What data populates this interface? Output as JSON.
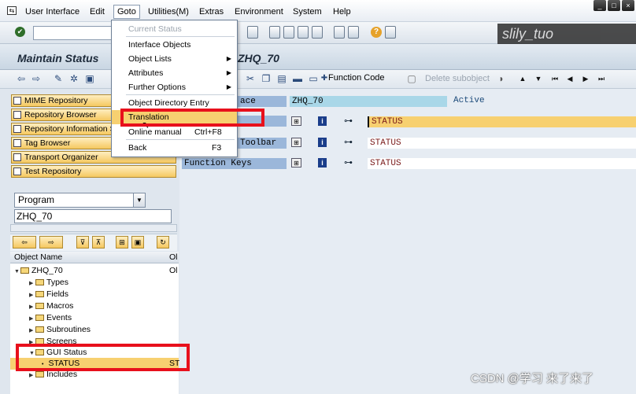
{
  "menubar": {
    "items": [
      "User Interface",
      "Edit",
      "Goto",
      "Utilities(M)",
      "Extras",
      "Environment",
      "System",
      "Help"
    ]
  },
  "title": {
    "left": "Maintain Status",
    "right": "ZHQ_70"
  },
  "app_toolbar": {
    "function_code": "Function Code",
    "delete_subobject": "Delete subobject"
  },
  "nav_buttons": [
    "MIME Repository",
    "Repository Browser",
    "Repository Information S",
    "Tag Browser",
    "Transport Organizer",
    "Test Repository"
  ],
  "object_selector": {
    "type": "Program",
    "name": "ZHQ_70"
  },
  "tree": {
    "header": "Object Name",
    "header_right": "Ol",
    "root": "ZHQ_70",
    "children": [
      "Types",
      "Fields",
      "Macros",
      "Events",
      "Subroutines",
      "Screens"
    ],
    "gui_status": "GUI Status",
    "gui_status_child": "STATUS",
    "gui_status_child_right": "ST",
    "includes": "Includes"
  },
  "right_pane": {
    "interface_label": "ace",
    "interface_value": "ZHQ_70",
    "interface_status": "Active",
    "rows": [
      {
        "label": "",
        "value": "STATUS"
      },
      {
        "label": "Toolbar",
        "value": "STATUS"
      },
      {
        "label": "Function Keys",
        "value": "STATUS"
      }
    ]
  },
  "dropdown": {
    "items": [
      {
        "label": "Current Status",
        "disabled": true
      },
      {
        "label": "Interface Objects"
      },
      {
        "label": "Object Lists",
        "submenu": true
      },
      {
        "label": "Attributes",
        "submenu": true
      },
      {
        "label": "Further Options",
        "submenu": true
      },
      {
        "label": "Object Directory Entry"
      },
      {
        "label": "Translation",
        "selected": true
      },
      {
        "label": "Online manual",
        "shortcut": "Ctrl+F8"
      },
      {
        "label": "Back",
        "shortcut": "F3"
      }
    ]
  },
  "watermarks": {
    "top": "slily_tuo",
    "bottom": "CSDN @学习 来了来了"
  },
  "colors": {
    "highlight": "#e8101c",
    "selected_menu": "#f7d070",
    "label_bg": "#9bb7da"
  }
}
